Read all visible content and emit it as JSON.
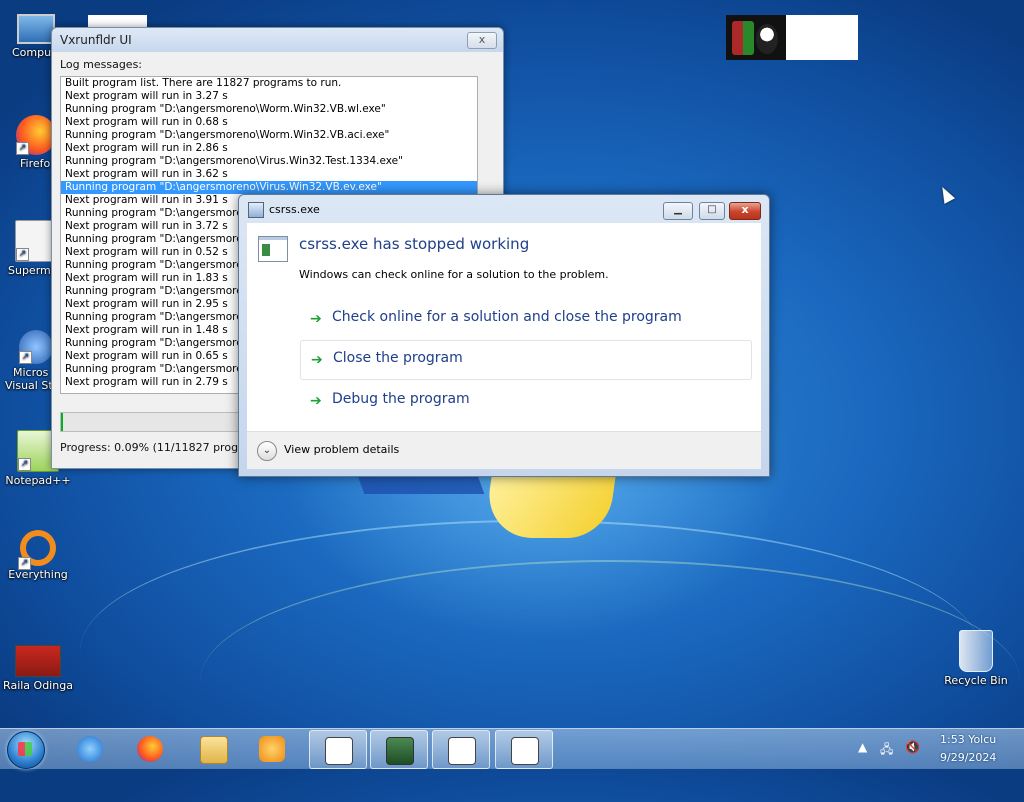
{
  "desktop": {
    "icons": [
      {
        "label": "Compu"
      },
      {
        "label": "Firefo"
      },
      {
        "label": "Supermi"
      },
      {
        "label": "Micros"
      },
      {
        "label": "Visual St"
      },
      {
        "label": "Notepad++"
      },
      {
        "label": "Everything"
      },
      {
        "label": "Raila Odinga"
      },
      {
        "label": "Recycle Bin"
      }
    ]
  },
  "vxwindow": {
    "title": "Vxrunfldr UI",
    "log_label": "Log messages:",
    "log_lines": [
      "Built program list. There are 11827 programs to run.",
      "Next program will run in 3.27 s",
      "Running program \"D:\\angersmoreno\\Worm.Win32.VB.wl.exe\"",
      "Next program will run in 0.68 s",
      "Running program \"D:\\angersmoreno\\Worm.Win32.VB.aci.exe\"",
      "Next program will run in 2.86 s",
      "Running program \"D:\\angersmoreno\\Virus.Win32.Test.1334.exe\"",
      "Next program will run in 3.62 s",
      "Running program \"D:\\angersmoreno\\Virus.Win32.VB.ev.exe\"",
      "Next program will run in 3.91 s",
      "Running program \"D:\\angersmoreno",
      "Next program will run in 3.72 s",
      "Running program \"D:\\angersmoreno",
      "Next program will run in 0.52 s",
      "Running program \"D:\\angersmoreno",
      "Next program will run in 1.83 s",
      "Running program \"D:\\angersmoreno\\",
      "Next program will run in 2.95 s",
      "Running program \"D:\\angersmoreno",
      "Next program will run in 1.48 s",
      "Running program \"D:\\angersmoreno",
      "Next program will run in 0.65 s",
      "Running program \"D:\\angersmoreno",
      "Next program will run in 2.79 s"
    ],
    "selected_line_index": 8,
    "progress_text": "Progress: 0.09% (11/11827 programs",
    "progress_fraction": 0.0009
  },
  "dialog": {
    "title": "csrss.exe",
    "heading": "csrss.exe has stopped working",
    "subtext": "Windows can check online for a solution to the problem.",
    "commands": [
      "Check online for a solution and close the program",
      "Close the program",
      "Debug the program"
    ],
    "details_label": "View problem details",
    "close_glyph": "x"
  },
  "taskbar": {
    "time": "1:53 Yolcu",
    "date": "9/29/2024"
  }
}
